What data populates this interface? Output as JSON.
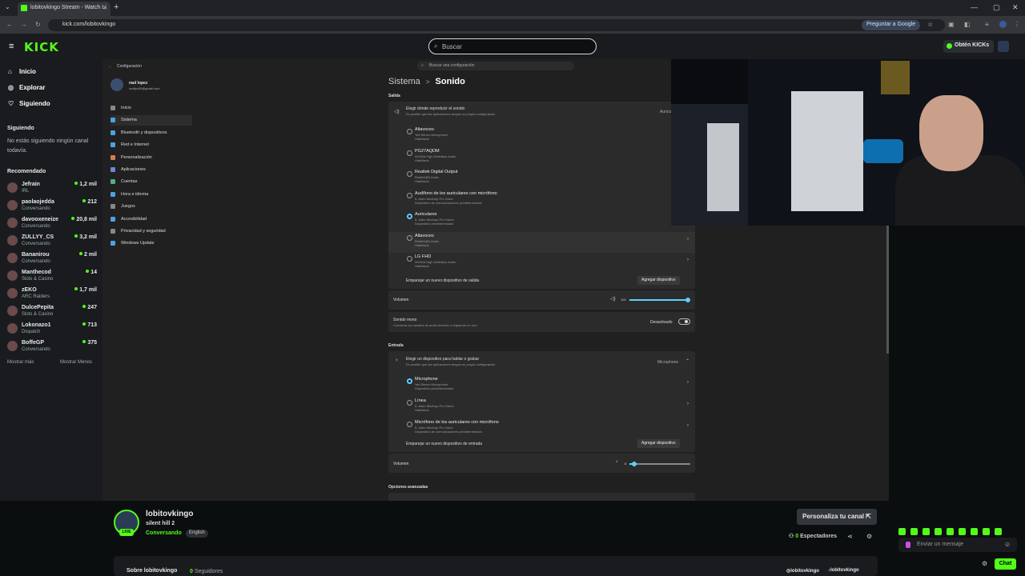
{
  "browser": {
    "tab_title": "lobitovkingo Stream - Watch Li",
    "url": "kick.com/lobitovkingo",
    "google_btn": "Preguntar a Google"
  },
  "header": {
    "logo": "KICK",
    "search_placeholder": "Buscar",
    "get_kicks": "Obtén KICKs"
  },
  "sidebar": {
    "nav": [
      {
        "label": "Inicio",
        "icon": "home-icon"
      },
      {
        "label": "Explorar",
        "icon": "compass-icon"
      },
      {
        "label": "Siguiendo",
        "icon": "heart-icon"
      }
    ],
    "following_title": "Siguiendo",
    "following_empty": "No estás siguiendo ningún canal todavía.",
    "recommended_title": "Recomendado",
    "recommended": [
      {
        "name": "Jefrain",
        "cat": "IRL",
        "viewers": "1,2 mil"
      },
      {
        "name": "paolaojedda",
        "cat": "Conversando",
        "viewers": "212"
      },
      {
        "name": "davooxeneize",
        "cat": "Conversando",
        "viewers": "20,8 mil"
      },
      {
        "name": "ZULLYY_CS",
        "cat": "Conversando",
        "viewers": "3,2 mil"
      },
      {
        "name": "Bananirou",
        "cat": "Conversando",
        "viewers": "2 mil"
      },
      {
        "name": "Manthecod",
        "cat": "Slots & Casino",
        "viewers": "14"
      },
      {
        "name": "zEKO",
        "cat": "ARC Raiders",
        "viewers": "1,7 mil"
      },
      {
        "name": "DulcePepita",
        "cat": "Slots & Casino",
        "viewers": "247"
      },
      {
        "name": "Lokonazo1",
        "cat": "Dispatch",
        "viewers": "713"
      },
      {
        "name": "BoffeGP",
        "cat": "Conversando",
        "viewers": "375"
      }
    ],
    "show_more": "Mostrar más",
    "show_less": "Mostrar Menos"
  },
  "settings": {
    "title": "Configuración",
    "user_name": "raul lopez",
    "user_email": "raullpz50@gmail.com",
    "search": "Buscar una configuración",
    "menu": [
      {
        "label": "Inicio",
        "color": "#888"
      },
      {
        "label": "Sistema",
        "color": "#4aa3df"
      },
      {
        "label": "Bluetooth y dispositivos",
        "color": "#4aa3df"
      },
      {
        "label": "Red e Internet",
        "color": "#4aa3df"
      },
      {
        "label": "Personalización",
        "color": "#d08050"
      },
      {
        "label": "Aplicaciones",
        "color": "#6a8ad0"
      },
      {
        "label": "Cuentas",
        "color": "#50b080"
      },
      {
        "label": "Hora e idioma",
        "color": "#4aa3df"
      },
      {
        "label": "Juegos",
        "color": "#888"
      },
      {
        "label": "Accesibilidad",
        "color": "#4aa3df"
      },
      {
        "label": "Privacidad y seguridad",
        "color": "#888"
      },
      {
        "label": "Windows Update",
        "color": "#4aa3df"
      }
    ],
    "bc_parent": "Sistema",
    "bc_sep": ">",
    "bc_current": "Sonido",
    "output_h": "Salida",
    "choose_out": "Elegir dónde reproducir el sonido",
    "choose_out_sub": "Es posible que las aplicaciones tengan su propia configuración",
    "choose_out_right": "Auricu",
    "outputs": [
      {
        "name": "Altavoces",
        "l2": "Yeti Stereo Microphone",
        "l3": "Habilitado",
        "on": false
      },
      {
        "name": "PG27AQDM",
        "l2": "NVIDIA High Definition Audio",
        "l3": "Habilitado",
        "on": false
      },
      {
        "name": "Realtek Digital Output",
        "l2": "Realtek(R) Audio",
        "l3": "Habilitado",
        "on": false
      },
      {
        "name": "Audífono de los auriculares con micrófono",
        "l2": "5- Astro MixAmp Pro Voice",
        "l3": "Dispositivo de comunicaciones predeterminado",
        "on": false
      },
      {
        "name": "Auriculares",
        "l2": "5- Astro MixAmp Pro Game",
        "l3": "Dispositivo predeterminado",
        "on": true
      },
      {
        "name": "Altavoces",
        "l2": "Realtek(R) Audio",
        "l3": "Habilitado",
        "on": false
      },
      {
        "name": "LG FHD",
        "l2": "NVIDIA High Definition Audio",
        "l3": "Habilitado",
        "on": false
      }
    ],
    "pair_out": "Emparejar un nuevo dispositivo de salida",
    "add_device": "Agregar dispositivo",
    "volume": "Volumen",
    "volume_out_val": "100",
    "volume_out_level": 1.0,
    "mono": "Sonido mono",
    "mono_sub": "Combinar los canales de audio derecho e izquierdo en uno",
    "mono_state": "Desactivado",
    "input_h": "Entrada",
    "choose_in": "Elegir un dispositivo para hablar o grabar",
    "choose_in_sub": "Es posible que las aplicaciones tengan su propia configuración",
    "choose_in_right": "Microphone",
    "inputs": [
      {
        "name": "Microphone",
        "l2": "Yeti Stereo Microphone",
        "l3": "Dispositivo predeterminado",
        "on": true
      },
      {
        "name": "Línea",
        "l2": "5- Astro MixAmp Pro Game",
        "l3": "Habilitado",
        "on": false
      },
      {
        "name": "Micrófono de los auriculares con micrófono",
        "l2": "5- Astro MixAmp Pro Voice",
        "l3": "Dispositivo de comunicaciones predeterminado",
        "on": false
      }
    ],
    "pair_in": "Emparejar un nuevo dispositivo de entrada",
    "volume_in_val": "8",
    "volume_in_level": 0.08,
    "advanced": "Opciones avanzadas"
  },
  "channel": {
    "name": "lobitovkingo",
    "game": "silent hill 2",
    "category": "Conversando",
    "language": "English",
    "live": "LIVE",
    "customize": "Personaliza tu canal",
    "viewers_count": "0",
    "viewers_label": "Espectadores",
    "about": "Sobre lobitovkingo",
    "followers_count": "0",
    "followers_label": "Seguidores",
    "instagram": "lobitovkingo",
    "tiktok": "lobitovkingo"
  },
  "chat": {
    "placeholder": "Enviar un mensaje",
    "send": "Chat"
  }
}
